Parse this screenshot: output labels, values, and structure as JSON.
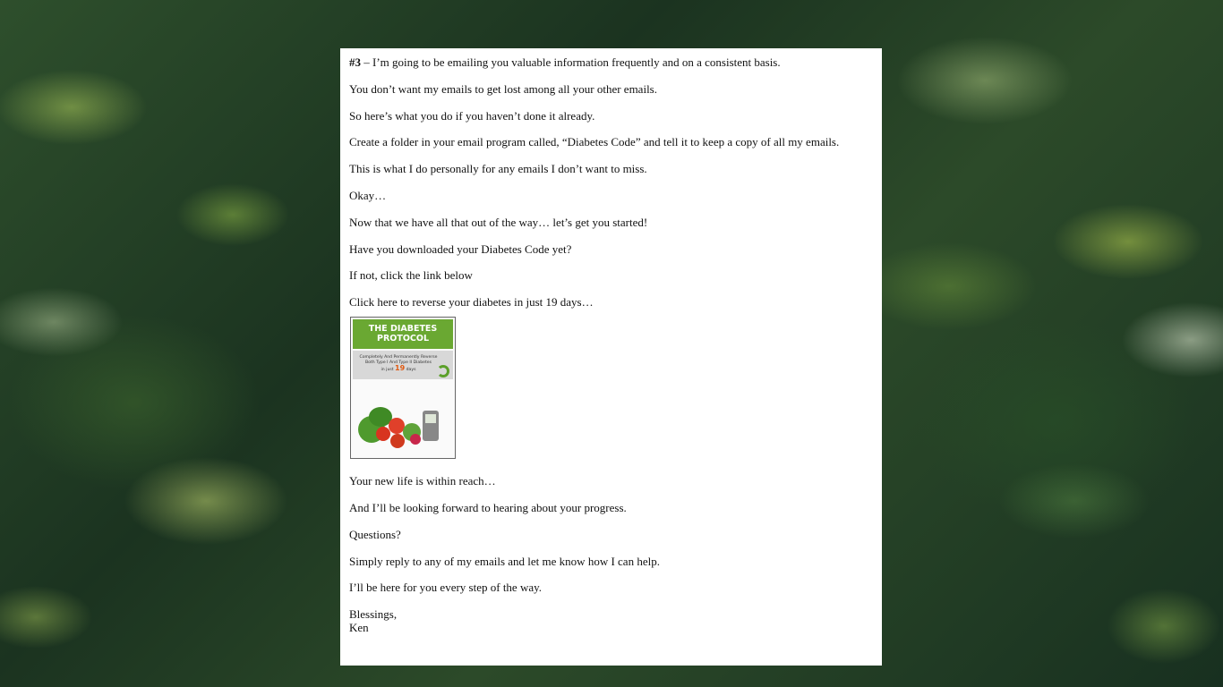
{
  "email": {
    "tip_number": "#3",
    "paragraphs_top": [
      " – I’m going to be emailing you valuable information frequently and on a consistent basis.",
      "You don’t want my emails to get lost among all your other emails.",
      "So here’s what you do if you haven’t done it already.",
      "Create a folder in your email program called, “Diabetes Code” and tell it to keep a copy of all my emails.",
      "This is what I do personally for any emails I don’t want to miss.",
      "Okay…",
      "Now that we have all that out of the way… let’s get you started!",
      "Have you downloaded your Diabetes Code yet?",
      "If not, click the link below",
      "Click here to reverse your diabetes in just 19 days…"
    ],
    "book": {
      "title_line1": "THE DIABETES",
      "title_line2": "PROTOCOL",
      "subtitle": "Completely And Permanently Reverse Both Type I And Type II Diabetes",
      "in_just": "in just",
      "days_num": "19",
      "days_word": "days",
      "title_color": "#6aa832",
      "accent_color": "#e05a12"
    },
    "paragraphs_bottom": [
      "Your new life is within reach…",
      "And I’ll be looking forward to hearing about your progress.",
      "Questions?",
      "Simply reply to any of my emails and let me know how I can help.",
      "I’ll be here for you every step of the way."
    ],
    "signoff": "Blessings,",
    "signature": "Ken"
  }
}
